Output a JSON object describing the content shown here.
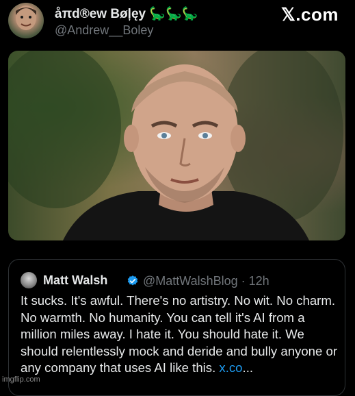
{
  "tweet": {
    "display_name": "åπd®ew Bøļęy 🦕🦕🦕",
    "handle": "@Andrew__Boley",
    "platform": "𝕏.com"
  },
  "quoted_tweet": {
    "name": "Matt Walsh",
    "handle_time": "@MattWalshBlog · 12h",
    "body": "It sucks. It's awful. There's no artistry. No wit. No charm. No warmth. No humanity. You can tell it's AI from a million miles away. I hate it. You should hate it. We should relentlessly mock and deride and bully anyone or any company that uses AI like this. ",
    "link": "x.co",
    "ellipsis": "..."
  },
  "watermark": "imgflip.com",
  "colors": {
    "background": "#000000",
    "text": "#e7e9ea",
    "muted": "#71767b",
    "link": "#1d9bf0",
    "border": "#2f3336"
  },
  "icons": {
    "verified": "verified-badge-icon"
  }
}
